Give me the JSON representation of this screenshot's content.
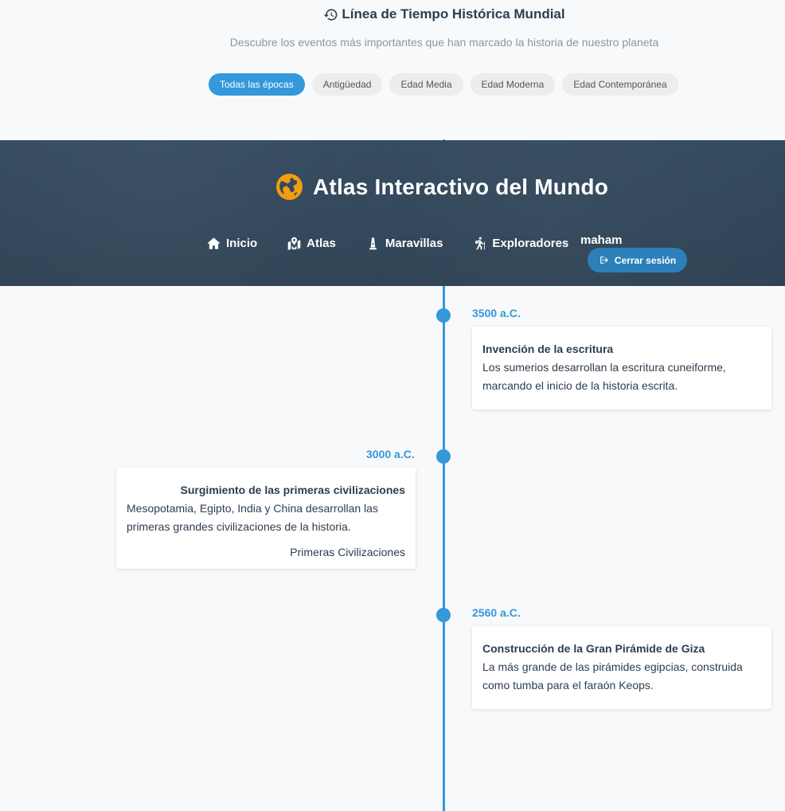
{
  "header": {
    "title": "Línea de Tiempo Histórica Mundial",
    "subtitle": "Descubre los eventos más importantes que han marcado la historia de nuestro planeta",
    "history_icon": "history-icon"
  },
  "filters": [
    {
      "label": "Todas las épocas",
      "active": true
    },
    {
      "label": "Antigüedad",
      "active": false
    },
    {
      "label": "Edad Media",
      "active": false
    },
    {
      "label": "Edad Moderna",
      "active": false
    },
    {
      "label": "Edad Contemporánea",
      "active": false
    }
  ],
  "navbar": {
    "brand": "Atlas Interactivo del Mundo",
    "brand_icon": "globe-icon",
    "items": [
      {
        "label": "Inicio",
        "icon": "home-icon"
      },
      {
        "label": "Atlas",
        "icon": "map-icon"
      },
      {
        "label": "Maravillas",
        "icon": "monument-icon"
      },
      {
        "label": "Exploradores",
        "icon": "hiking-icon"
      }
    ],
    "user": "maham",
    "logout_label": "Cerrar sesión",
    "logout_icon": "sign-out-icon"
  },
  "events": [
    {
      "date": "3500 a.C.",
      "title": "Invención de la escritura",
      "description": "Los sumerios desarrollan la escritura cuneiforme, marcando el inicio de la historia escrita.",
      "tag": "",
      "side": "right"
    },
    {
      "date": "3000 a.C.",
      "title": "Surgimiento de las primeras civilizaciones",
      "description": "Mesopotamia, Egipto, India y China desarrollan las primeras grandes civilizaciones de la historia.",
      "tag": "Primeras Civilizaciones",
      "side": "left"
    },
    {
      "date": "2560 a.C.",
      "title": "Construcción de la Gran Pirámide de Giza",
      "description": "La más grande de las pirámides egipcias, construida como tumba para el faraón Keops.",
      "tag": "",
      "side": "right"
    }
  ],
  "colors": {
    "accent": "#3498db",
    "navbar": "#34495e",
    "text": "#2c3e50",
    "brand_icon": "#f39c12"
  }
}
